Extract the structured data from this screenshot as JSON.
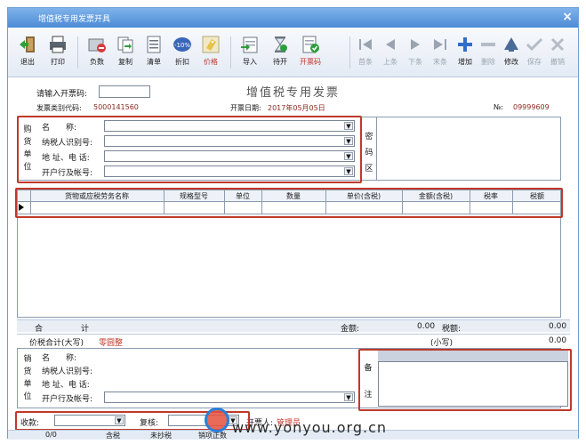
{
  "window": {
    "title": "增值税专用发票开具",
    "close_glyph": "×"
  },
  "toolbar": [
    {
      "name": "exit",
      "label": "退出",
      "enabled": true
    },
    {
      "name": "print",
      "label": "打印",
      "enabled": true
    },
    {
      "name": "negative",
      "label": "负数",
      "enabled": true
    },
    {
      "name": "copy",
      "label": "复制",
      "enabled": true
    },
    {
      "name": "list",
      "label": "清单",
      "enabled": true
    },
    {
      "name": "discount",
      "label": "折扣",
      "enabled": true
    },
    {
      "name": "price",
      "label": "价格",
      "enabled": true,
      "highlight": true
    },
    {
      "name": "import",
      "label": "导入",
      "enabled": true
    },
    {
      "name": "pending",
      "label": "待开",
      "enabled": true
    },
    {
      "name": "invoice-code",
      "label": "开票码",
      "enabled": true,
      "highlight": true
    },
    {
      "name": "first",
      "label": "首条",
      "enabled": false
    },
    {
      "name": "prev",
      "label": "上条",
      "enabled": false
    },
    {
      "name": "next",
      "label": "下条",
      "enabled": false
    },
    {
      "name": "last",
      "label": "末条",
      "enabled": false
    },
    {
      "name": "add",
      "label": "增加",
      "enabled": true
    },
    {
      "name": "delete",
      "label": "删除",
      "enabled": false
    },
    {
      "name": "modify",
      "label": "修改",
      "enabled": true
    },
    {
      "name": "save",
      "label": "保存",
      "enabled": false
    },
    {
      "name": "undo",
      "label": "撤销",
      "enabled": false
    }
  ],
  "invoice": {
    "heading": "增值税专用发票",
    "code_prompt": "请输入开票码:",
    "code_value": "",
    "type_code_label": "发票类别代码:",
    "type_code_value": "5000141560",
    "date_label": "开票日期:",
    "date_value": "2017年05月05日",
    "no_label": "№:",
    "no_value": "09999609"
  },
  "buyer": {
    "side_label": [
      "购",
      "货",
      "单",
      "位"
    ],
    "fields": [
      {
        "label": "名　　称:",
        "value": ""
      },
      {
        "label": "纳税人识别号:",
        "value": ""
      },
      {
        "label": "地 址、电 话:",
        "value": ""
      },
      {
        "label": "开户行及帐号:",
        "value": ""
      }
    ],
    "cipher_label": [
      "密",
      "码",
      "区"
    ]
  },
  "grid": {
    "columns": [
      "货物或应税劳务名称",
      "规格型号",
      "单位",
      "数量",
      "单价(含税)",
      "金额(含税)",
      "税率",
      "税额"
    ]
  },
  "totals": {
    "sum_label_1": "合",
    "sum_label_2": "计",
    "amount_label": "金额:",
    "amount_value": "0.00",
    "tax_label": "税额:",
    "tax_value": "0.00",
    "total_caps_label": "价税合计(大写)",
    "total_caps_value": "零圆整",
    "total_small_label": "(小写)",
    "total_small_value": "0.00"
  },
  "seller": {
    "side_label": [
      "销",
      "货",
      "单",
      "位"
    ],
    "fields": [
      {
        "label": "名　　称:",
        "value": ""
      },
      {
        "label": "纳税人识别号:",
        "value": ""
      },
      {
        "label": "地 址、电 话:",
        "value": ""
      },
      {
        "label": "开户行及帐号:",
        "value": ""
      }
    ],
    "remark_label": [
      "备",
      "注"
    ]
  },
  "footer": {
    "payee_label": "收款:",
    "payee_value": "",
    "reviewer_label": "复核:",
    "reviewer_value": "",
    "issuer_label": "开票人:",
    "issuer_value": "管理员"
  },
  "status": {
    "count": "0/0",
    "tax_mode": "含税",
    "copy_state": "未抄税",
    "sales_state": "销项正数"
  },
  "watermark": {
    "text": "www.yonyou.org.cn"
  },
  "colors": {
    "title_bar": "#4b8bd6",
    "highlight_box": "#c0392b",
    "accent_red": "#c0392b"
  }
}
